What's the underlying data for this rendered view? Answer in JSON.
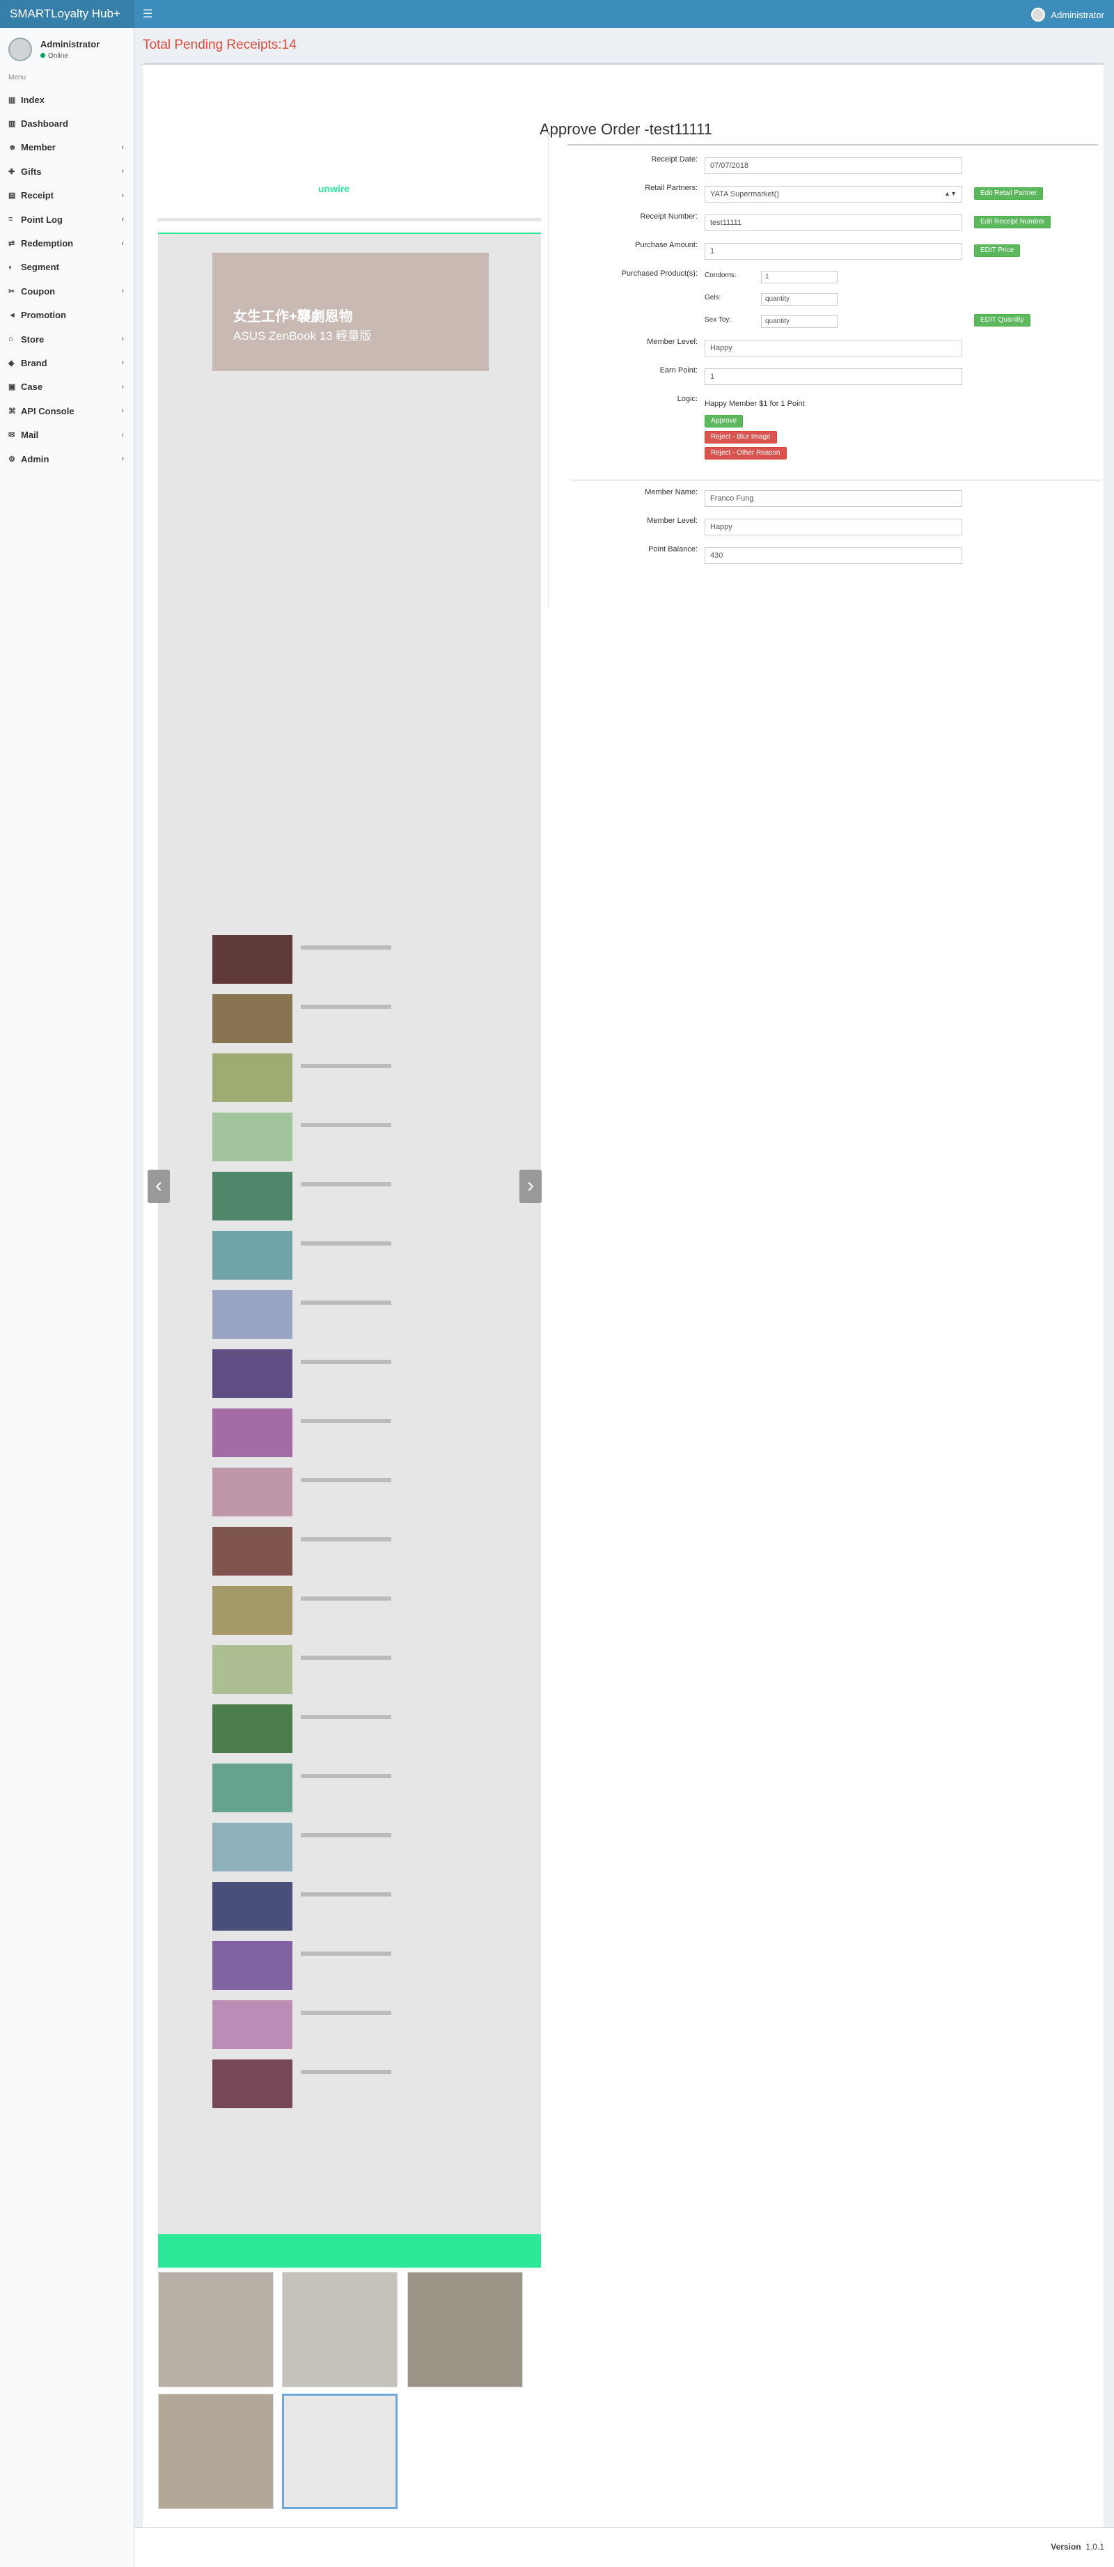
{
  "app": {
    "title": "SMARTLoyalty Hub+",
    "top_user": "Administrator"
  },
  "user": {
    "name": "Administrator",
    "status": "Online"
  },
  "menu_header": "Menu",
  "nav": [
    {
      "label": "Index",
      "icon": "chart-icon",
      "chevron": false
    },
    {
      "label": "Dashboard",
      "icon": "chart-icon",
      "chevron": false
    },
    {
      "label": "Member",
      "icon": "user-icon",
      "chevron": true
    },
    {
      "label": "Gifts",
      "icon": "gift-icon",
      "chevron": true
    },
    {
      "label": "Receipt",
      "icon": "receipt-icon",
      "chevron": true
    },
    {
      "label": "Point Log",
      "icon": "list-icon",
      "chevron": true
    },
    {
      "label": "Redemption",
      "icon": "exchange-icon",
      "chevron": true
    },
    {
      "label": "Segment",
      "icon": "segment-icon",
      "chevron": false
    },
    {
      "label": "Coupon",
      "icon": "ticket-icon",
      "chevron": true
    },
    {
      "label": "Promotion",
      "icon": "bullhorn-icon",
      "chevron": false
    },
    {
      "label": "Store",
      "icon": "store-icon",
      "chevron": true
    },
    {
      "label": "Brand",
      "icon": "tag-icon",
      "chevron": true
    },
    {
      "label": "Case",
      "icon": "case-icon",
      "chevron": true
    },
    {
      "label": "API Console",
      "icon": "code-icon",
      "chevron": true
    },
    {
      "label": "Mail",
      "icon": "mail-icon",
      "chevron": true
    },
    {
      "label": "Admin",
      "icon": "admin-icon",
      "chevron": true
    }
  ],
  "pending": "Total Pending Receipts:14",
  "order": {
    "title": "Approve Order -test11111",
    "receipt_date_label": "Receipt Date:",
    "receipt_date": "07/07/2018",
    "retail_partner_label": "Retail Partners:",
    "retail_partner": "YATA Supermarket()",
    "edit_retail_partner": "Edit Retail Partner",
    "receipt_number_label": "Receipt Number:",
    "receipt_number": "test11111",
    "edit_receipt_number": "Edit Receipt Number",
    "purchase_amount_label": "Purchase Amount:",
    "purchase_amount": "1",
    "edit_price": "EDIT Price",
    "purchased_products_label": "Purchased Product(s):",
    "products": [
      {
        "label": "Condoms:",
        "value": "1",
        "placeholder": ""
      },
      {
        "label": "Gels:",
        "value": "",
        "placeholder": "quantity"
      },
      {
        "label": "Sex Toy:",
        "value": "",
        "placeholder": "quantity"
      }
    ],
    "edit_quantity": "EDIT Quantity",
    "member_level_label": "Member Level:",
    "member_level": "Happy",
    "earn_point_label": "Earn Point:",
    "earn_point": "1",
    "logic_label": "Logic:",
    "logic": "Happy Member $1 for 1 Point",
    "approve": "Approve",
    "reject_blur": "Reject - Blur Image",
    "reject_other": "Reject - Other Reason",
    "member_name_label": "Member Name:",
    "member_name": "Franco Fung",
    "member_level2_label": "Member Level:",
    "member_level2": "Happy",
    "point_balance_label": "Point Balance:",
    "point_balance": "430"
  },
  "shot_banner": "ASUS ZenBook 13 輕量版",
  "shot_headline": "女生工作+襲劇恩物",
  "shot_brand": "unwire",
  "footer": {
    "version_label": "Version",
    "version": "1.0.1"
  }
}
